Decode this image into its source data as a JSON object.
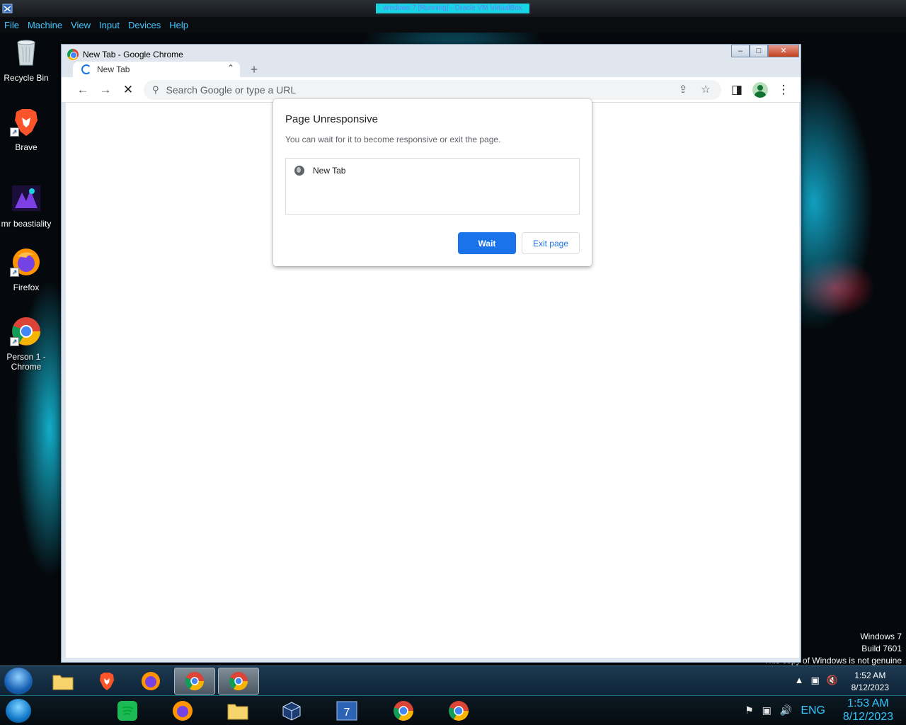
{
  "host": {
    "window_title": "windows 7 [Running] - Oracle VM VirtualBox",
    "menu": [
      "File",
      "Machine",
      "View",
      "Input",
      "Devices",
      "Help"
    ]
  },
  "desktop": {
    "icons": [
      {
        "label": "Recycle Bin",
        "icon": "recycle-bin-icon"
      },
      {
        "label": "Brave",
        "icon": "brave-icon"
      },
      {
        "label": "mr beastiality",
        "icon": "image-file-icon"
      },
      {
        "label": "Firefox",
        "icon": "firefox-icon"
      },
      {
        "label": "Person 1 -\nChrome",
        "icon": "chrome-icon"
      }
    ],
    "watermark": {
      "line1": "Windows 7",
      "line2": "Build 7601",
      "line3": "This copy of Windows is not genuine"
    }
  },
  "chrome": {
    "window_title": "New Tab - Google Chrome",
    "tab_label": "New Tab",
    "omnibox_placeholder": "Search Google or type a URL",
    "dialog": {
      "title": "Page Unresponsive",
      "message": "You can wait for it to become responsive or exit the page.",
      "item": "New Tab",
      "wait_label": "Wait",
      "exit_label": "Exit page"
    }
  },
  "guest_taskbar": {
    "apps": [
      "windows-explorer",
      "brave",
      "firefox",
      "chrome-profile",
      "chrome-profile-active"
    ],
    "time": "1:52 AM",
    "date": "8/12/2023"
  },
  "host_taskbar": {
    "apps": [
      "spotify",
      "firefox",
      "file-explorer",
      "virtualbox",
      "windows-7-vm",
      "chrome",
      "chrome-profile"
    ],
    "lang": "ENG",
    "time": "1:53 AM",
    "date": "8/12/2023"
  },
  "colors": {
    "accent_blue": "#1a73e8",
    "host_cyan": "#33c6ff",
    "desktop_cyan": "#12afd2"
  }
}
